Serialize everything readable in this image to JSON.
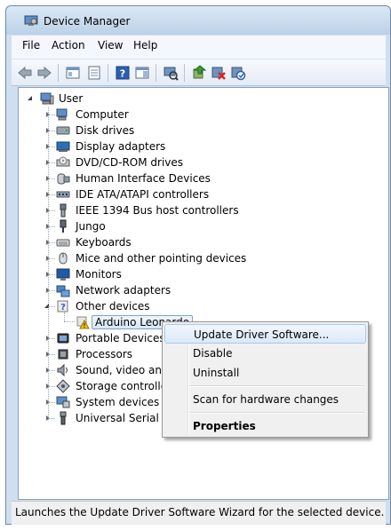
{
  "window": {
    "title": "Device Manager"
  },
  "menu": [
    {
      "label": "File"
    },
    {
      "label": "Action"
    },
    {
      "label": "View"
    },
    {
      "label": "Help"
    }
  ],
  "toolbar": {
    "buttons": [
      "back-icon",
      "forward-icon",
      "show-hide-console-tree-icon",
      "properties-icon",
      "help-icon",
      "show-action-pane-icon",
      "scan-hardware-changes-icon",
      "update-driver-icon",
      "uninstall-icon",
      "enable-device-icon"
    ]
  },
  "tree": {
    "root": {
      "label": "User",
      "icon": "computer-icon"
    },
    "items": [
      {
        "label": "Computer",
        "icon": "computer-icon"
      },
      {
        "label": "Disk drives",
        "icon": "disk-drive-icon"
      },
      {
        "label": "Display adapters",
        "icon": "display-adapter-icon"
      },
      {
        "label": "DVD/CD-ROM drives",
        "icon": "dvd-drive-icon"
      },
      {
        "label": "Human Interface Devices",
        "icon": "hid-icon"
      },
      {
        "label": "IDE ATA/ATAPI controllers",
        "icon": "ide-controller-icon"
      },
      {
        "label": "IEEE 1394 Bus host controllers",
        "icon": "firewire-icon"
      },
      {
        "label": "Jungo",
        "icon": "jungo-icon"
      },
      {
        "label": "Keyboards",
        "icon": "keyboard-icon"
      },
      {
        "label": "Mice and other pointing devices",
        "icon": "mouse-icon"
      },
      {
        "label": "Monitors",
        "icon": "monitor-icon"
      },
      {
        "label": "Network adapters",
        "icon": "network-adapter-icon"
      },
      {
        "label": "Other devices",
        "icon": "unknown-device-icon"
      },
      {
        "label": "Portable Devices",
        "icon": "portable-device-icon"
      },
      {
        "label": "Processors",
        "icon": "processor-icon"
      },
      {
        "label": "Sound, video and ga",
        "icon": "sound-icon"
      },
      {
        "label": "Storage controllers",
        "icon": "storage-controller-icon"
      },
      {
        "label": "System devices",
        "icon": "system-device-icon"
      },
      {
        "label": "Universal Serial Bus",
        "icon": "usb-icon"
      }
    ],
    "child": {
      "label": "Arduino Leonardo",
      "icon": "warning-device-icon",
      "parent": "Other devices"
    }
  },
  "context_menu": {
    "items": [
      {
        "label": "Update Driver Software..."
      },
      {
        "label": "Disable"
      },
      {
        "label": "Uninstall"
      },
      {
        "label": "Scan for hardware changes"
      },
      {
        "label": "Properties"
      }
    ]
  },
  "status": {
    "text": "Launches the Update Driver Software Wizard for the selected device."
  }
}
